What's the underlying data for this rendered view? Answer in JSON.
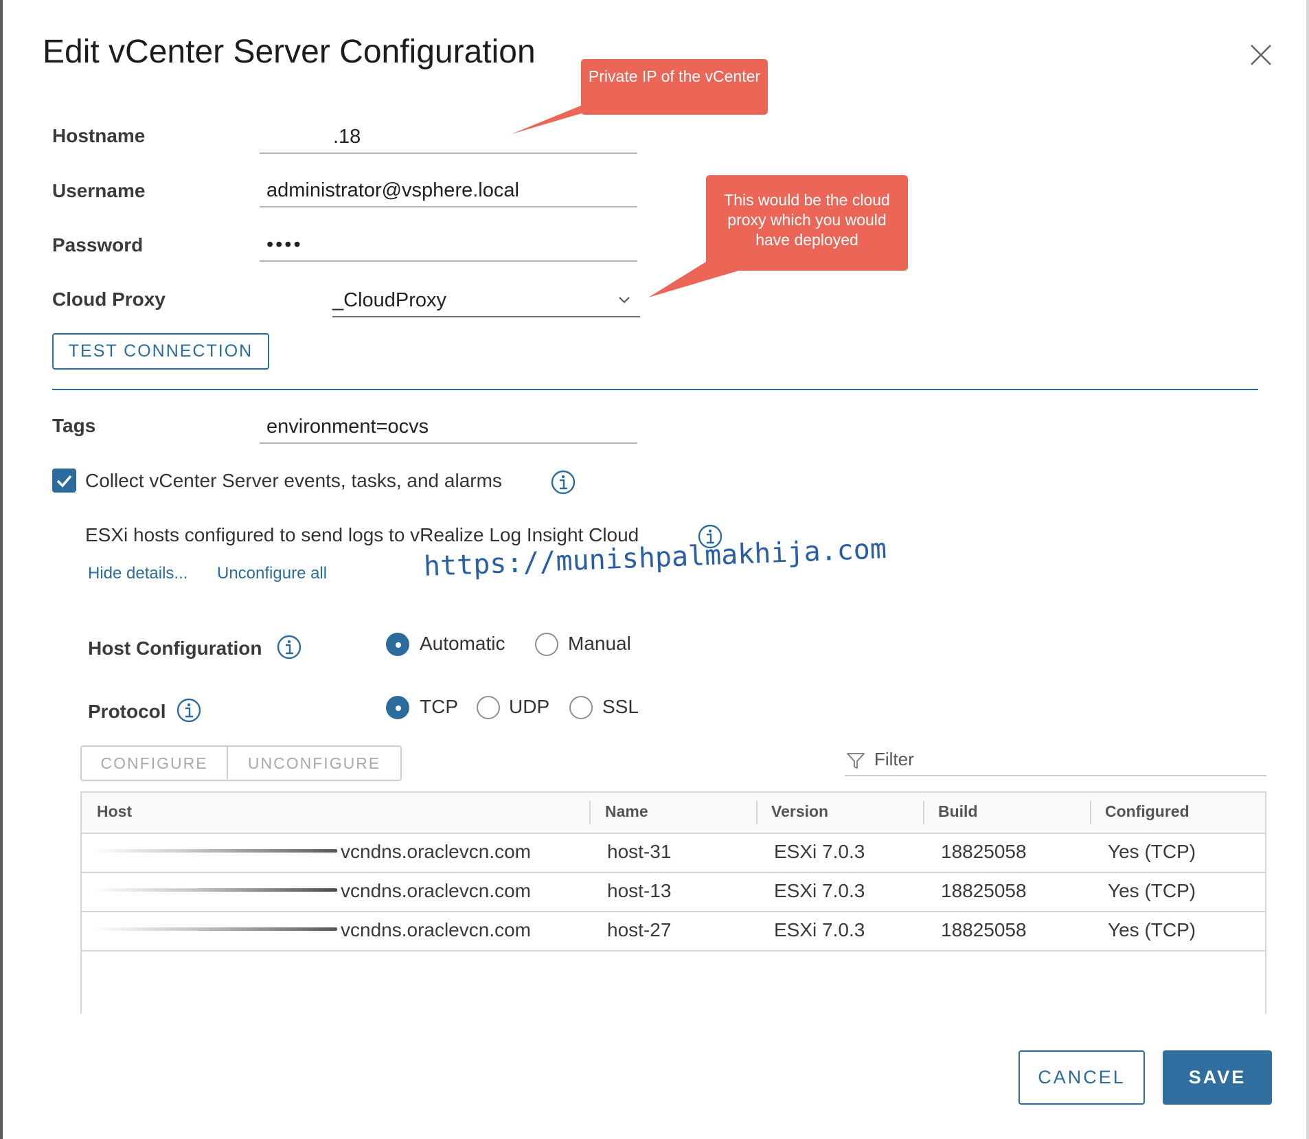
{
  "dialog": {
    "title": "Edit vCenter Server Configuration",
    "close_icon": "close-icon"
  },
  "form": {
    "hostname": {
      "label": "Hostname",
      "value": ".18"
    },
    "username": {
      "label": "Username",
      "value": "administrator@vsphere.local"
    },
    "password": {
      "label": "Password",
      "value": "••••"
    },
    "cloud_proxy": {
      "label": "Cloud Proxy",
      "value": "_CloudProxy",
      "icon": "chevron-down-icon"
    },
    "test_connection_label": "TEST CONNECTION",
    "tags": {
      "label": "Tags",
      "value": "environment=ocvs"
    }
  },
  "collect": {
    "checked": true,
    "label": "Collect vCenter Server events, tasks, and alarms",
    "icon": "info-icon"
  },
  "esxi": {
    "heading": "ESXi hosts configured to send logs to vRealize Log Insight Cloud",
    "hide_details": "Hide details...",
    "unconfigure_all": "Unconfigure all"
  },
  "host_configuration": {
    "label": "Host Configuration",
    "options": [
      "Automatic",
      "Manual"
    ],
    "selected": "Automatic"
  },
  "protocol": {
    "label": "Protocol",
    "options": [
      "TCP",
      "UDP",
      "SSL"
    ],
    "selected": "TCP"
  },
  "toolbar": {
    "configure": "CONFIGURE",
    "unconfigure": "UNCONFIGURE",
    "filter_placeholder": "Filter",
    "filter_icon": "filter-icon"
  },
  "table": {
    "columns": [
      "Host",
      "Name",
      "Version",
      "Build",
      "Configured"
    ],
    "rows": [
      {
        "host": "vcndns.oraclevcn.com",
        "name": "host-31",
        "version": "ESXi 7.0.3",
        "build": "18825058",
        "configured": "Yes (TCP)"
      },
      {
        "host": "vcndns.oraclevcn.com",
        "name": "host-13",
        "version": "ESXi 7.0.3",
        "build": "18825058",
        "configured": "Yes (TCP)"
      },
      {
        "host": "vcndns.oraclevcn.com",
        "name": "host-27",
        "version": "ESXi 7.0.3",
        "build": "18825058",
        "configured": "Yes (TCP)"
      }
    ]
  },
  "footer": {
    "cancel": "CANCEL",
    "save": "SAVE"
  },
  "annotations": {
    "callout_hostname": "Private IP of the vCenter",
    "callout_proxy": "This would be the cloud proxy which you would have deployed",
    "watermark": "https://munishpalmakhija.com",
    "callout_color": "#ec6657"
  },
  "colors": {
    "accent": "#2c6c9c",
    "save_bg": "#2f6e9e"
  }
}
